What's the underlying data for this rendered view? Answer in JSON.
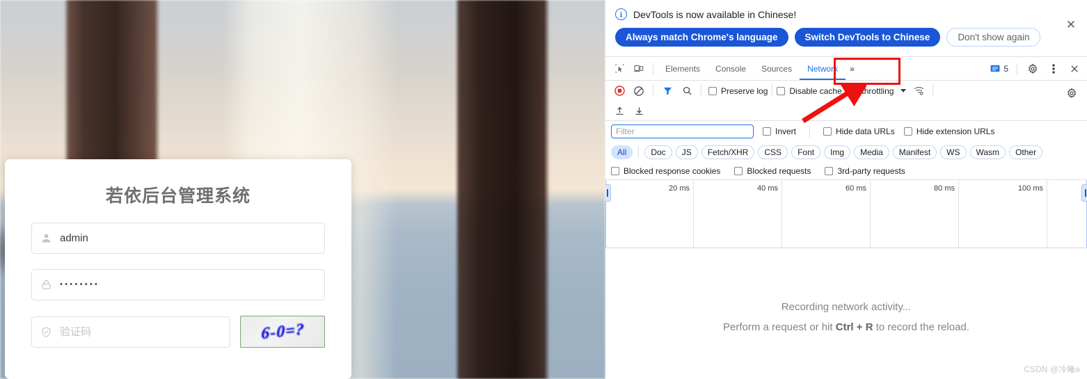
{
  "login": {
    "title": "若依后台管理系统",
    "username": {
      "icon": "user-icon",
      "value": "admin"
    },
    "password": {
      "icon": "lock-icon",
      "value": "••••••••"
    },
    "captcha": {
      "icon": "shield-check-icon",
      "placeholder": "验证码",
      "image_text": "6-0=?"
    }
  },
  "devtools": {
    "infobar": {
      "icon": "info-icon",
      "message": "DevTools is now available in Chinese!",
      "buttons": [
        {
          "label": "Always match Chrome's language",
          "style": "primary"
        },
        {
          "label": "Switch DevTools to Chinese",
          "style": "primary"
        },
        {
          "label": "Don't show again",
          "style": "ghost"
        }
      ],
      "close_icon": "close-icon"
    },
    "tabstrip": {
      "inspect_icon": "inspect-element-icon",
      "device_icon": "device-toolbar-icon",
      "tabs": [
        {
          "label": "Elements",
          "active": false
        },
        {
          "label": "Console",
          "active": false
        },
        {
          "label": "Sources",
          "active": false
        },
        {
          "label": "Network",
          "active": true
        }
      ],
      "more_tabs": "»",
      "issues": {
        "icon": "issues-icon",
        "count": "5"
      },
      "settings_icon": "gear-icon",
      "menu_icon": "kebab-menu-icon",
      "close_icon": "close-icon"
    },
    "network_toolbar": {
      "record_icon": "record-stop-icon",
      "clear_icon": "clear-icon",
      "filter_icon": "funnel-icon",
      "search_icon": "search-icon",
      "preserve_log": {
        "label": "Preserve log",
        "checked": false
      },
      "disable_cache": {
        "label": "Disable cache",
        "checked": false
      },
      "throttling": {
        "value": "No throttling",
        "caret": "chevron-down-icon"
      },
      "wifi_icon": "network-conditions-icon",
      "settings_icon": "gear-icon",
      "import_icon": "import-har-icon",
      "export_icon": "export-har-icon"
    },
    "filter_bar": {
      "placeholder": "Filter",
      "value": "",
      "invert": {
        "label": "Invert",
        "checked": false
      },
      "hide_data_urls": {
        "label": "Hide data URLs",
        "checked": false
      },
      "hide_extension_urls": {
        "label": "Hide extension URLs",
        "checked": false
      }
    },
    "type_chips": [
      {
        "label": "All",
        "selected": true
      },
      {
        "label": "Doc",
        "selected": false
      },
      {
        "label": "JS",
        "selected": false
      },
      {
        "label": "Fetch/XHR",
        "selected": false
      },
      {
        "label": "CSS",
        "selected": false
      },
      {
        "label": "Font",
        "selected": false
      },
      {
        "label": "Img",
        "selected": false
      },
      {
        "label": "Media",
        "selected": false
      },
      {
        "label": "Manifest",
        "selected": false
      },
      {
        "label": "WS",
        "selected": false
      },
      {
        "label": "Wasm",
        "selected": false
      },
      {
        "label": "Other",
        "selected": false
      }
    ],
    "extra_checkboxes": [
      {
        "label": "Blocked response cookies",
        "checked": false
      },
      {
        "label": "Blocked requests",
        "checked": false
      },
      {
        "label": "3rd-party requests",
        "checked": false
      }
    ],
    "overview": {
      "tick_labels": [
        "20 ms",
        "40 ms",
        "60 ms",
        "80 ms",
        "100 ms"
      ],
      "tick_values": [
        20,
        40,
        60,
        80,
        100
      ],
      "unit": "ms"
    },
    "empty_state": {
      "line1": "Recording network activity...",
      "line2_prefix": "Perform a request or hit ",
      "line2_shortcut": "Ctrl + R",
      "line2_suffix": " to record the reload."
    },
    "watermark": "CSDN @冷曦a"
  },
  "annotations": {
    "box_target": "Network",
    "arrow_target": "Disable cache",
    "color": "#ee1111"
  }
}
